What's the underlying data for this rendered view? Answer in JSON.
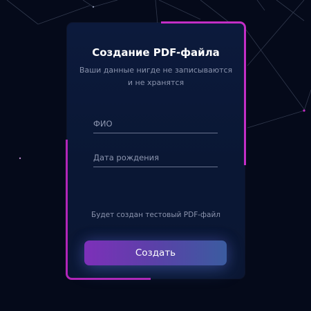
{
  "form": {
    "title": "Создание PDF-файла",
    "subtitle_line1": "Ваши данные нигде не записываются",
    "subtitle_line2": "и не хранятся",
    "fio_placeholder": "ФИО",
    "dob_placeholder": "Дата рождения",
    "note": "Будет создан тестовый PDF-файл",
    "submit_label": "Создать"
  },
  "colors": {
    "background": "#050a1a",
    "card": "#0b1836",
    "accent": "#c42ec6",
    "button_start": "#7d30b9",
    "button_end": "#3b5ca0"
  }
}
